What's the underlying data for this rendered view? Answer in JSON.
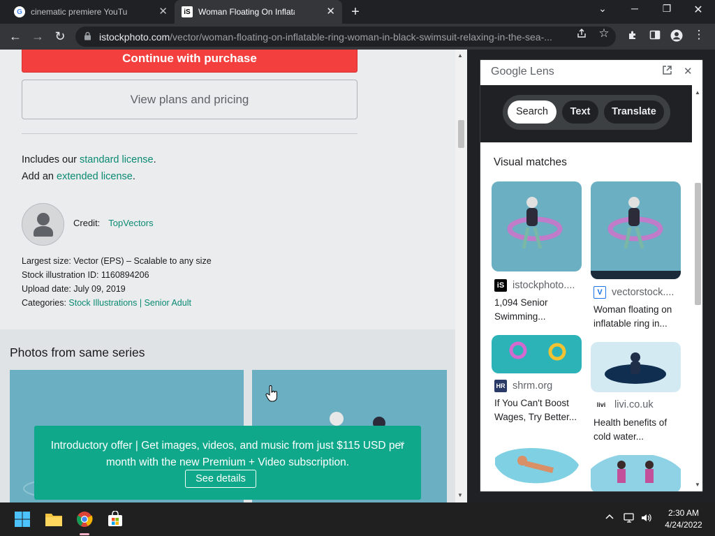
{
  "tabs": [
    {
      "title": "cinematic premiere YouTube cou",
      "favicon": "google-g",
      "active": false
    },
    {
      "title": "Woman Floating On Inflatable Ri",
      "favicon": "istock-logo",
      "active": true
    }
  ],
  "icons": {
    "new_tab": "+",
    "minimize": "─",
    "chevron": "⌄",
    "restore": "❐",
    "close": "✕",
    "back": "←",
    "forward": "→",
    "reload": "↻",
    "lock": "🔒",
    "share": "⇪",
    "star": "☆",
    "extensions": "✱",
    "sidepanel": "▯",
    "profile": "●",
    "menu": "⋮"
  },
  "address_bar": {
    "host": "istockphoto.com",
    "path": "/vector/woman-floating-on-inflatable-ring-woman-in-black-swimsuit-relaxing-in-the-sea-..."
  },
  "page": {
    "continue_label": "Continue with purchase",
    "plans_label": "View plans and pricing",
    "license_line1_prefix": "Includes our ",
    "license_line1_link": "standard license",
    "license_line1_suffix": ".",
    "license_line2_prefix": "Add an ",
    "license_line2_link": "extended license",
    "license_line2_suffix": ".",
    "credit_label": "Credit:",
    "credit_name": "TopVectors",
    "largest_size": "Largest size: Vector (EPS) – Scalable to any size",
    "stock_id": "Stock illustration ID: 1160894206",
    "upload_date": "Upload date: July 09, 2019",
    "categories_label": "Categories: ",
    "categories_links": "Stock Illustrations | Senior Adult",
    "series_title": "Photos from same series",
    "promo_text": "Introductory offer | Get images, videos, and music from just $115 USD per month with the new Premium + Video subscription.",
    "promo_button": "See details",
    "promo_close": "×"
  },
  "lens": {
    "title": "Google Lens",
    "tabs": [
      "Search",
      "Text",
      "Translate"
    ],
    "active_tab": "Search",
    "section_title": "Visual matches",
    "results": [
      {
        "source": "istockphoto....",
        "caption": "1,094 Senior Swimming..."
      },
      {
        "source": "vectorstock....",
        "caption": "Woman floating on inflatable ring in..."
      },
      {
        "source": "shrm.org",
        "caption": "If You Can't Boost Wages, Try Better..."
      },
      {
        "source": "livi.co.uk",
        "caption": "Health benefits of cold water..."
      }
    ],
    "source_icons": [
      "iS",
      "V",
      "HR",
      "livi"
    ]
  },
  "taskbar": {
    "time": "2:30 AM",
    "date": "4/24/2022",
    "tray_icons": [
      "chevron-up-icon",
      "network-icon",
      "volume-icon"
    ]
  },
  "colors": {
    "accent_red": "#f3403f",
    "link_green": "#0b8a73",
    "promo_green": "#0fa88b",
    "illustration_blue": "#6aafc2"
  }
}
